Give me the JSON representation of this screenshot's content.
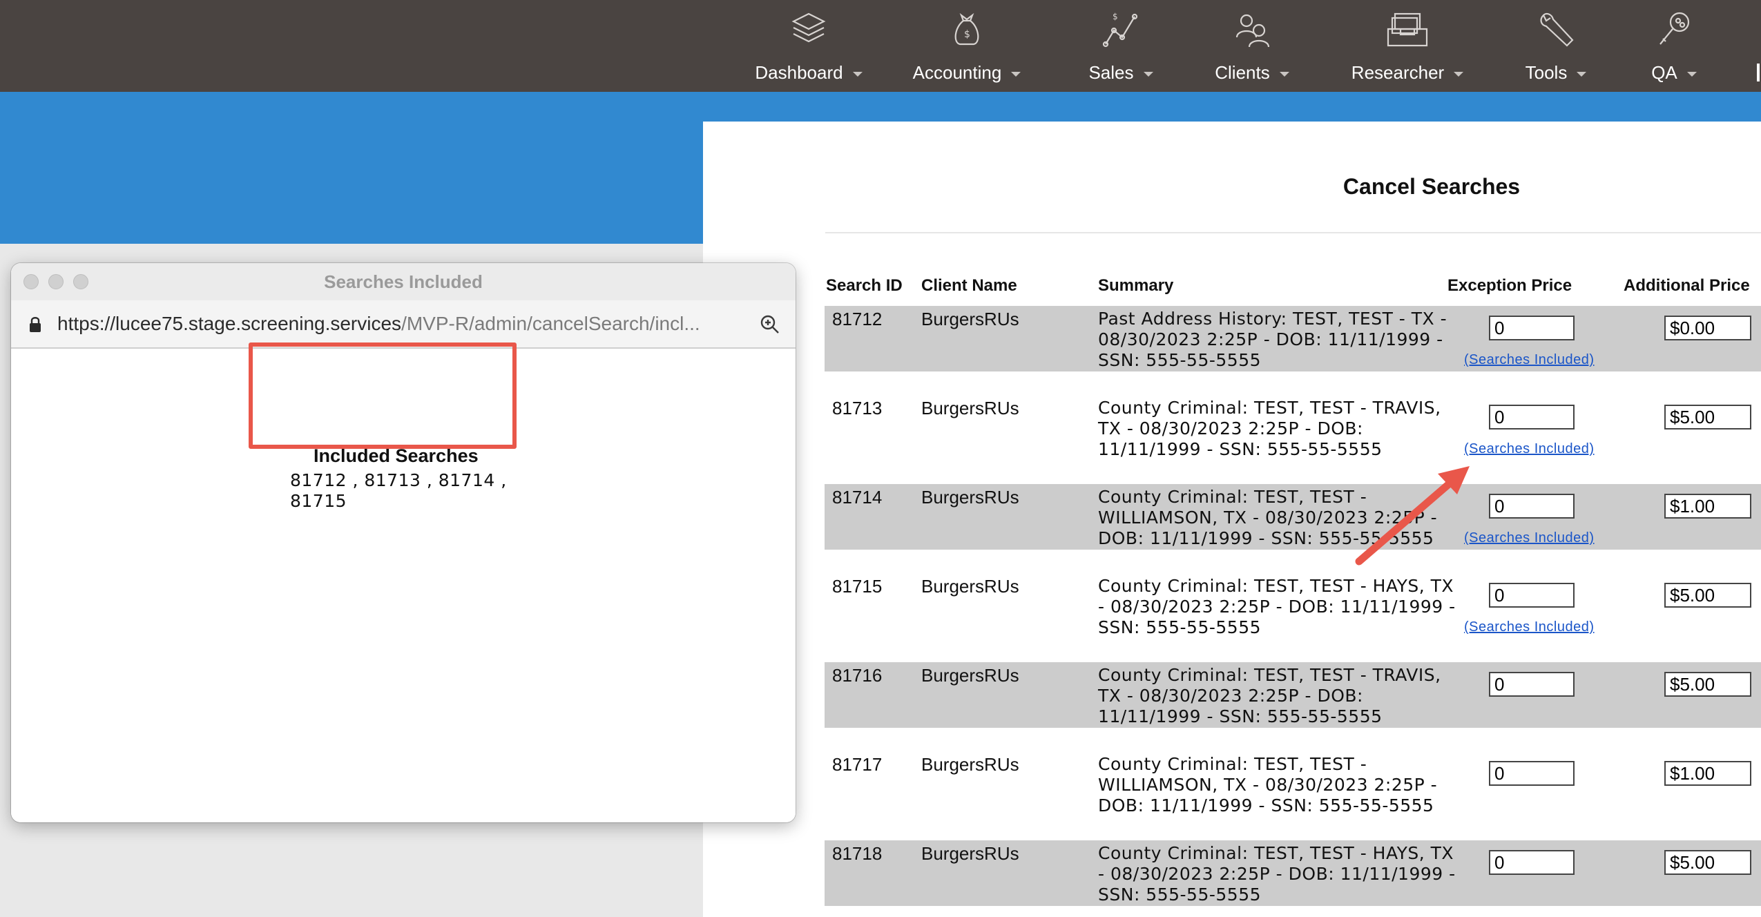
{
  "nav": {
    "items": [
      {
        "label": "Dashboard",
        "icon": "layers-icon"
      },
      {
        "label": "Accounting",
        "icon": "money-bag-icon"
      },
      {
        "label": "Sales",
        "icon": "sales-chart-icon"
      },
      {
        "label": "Clients",
        "icon": "users-icon"
      },
      {
        "label": "Researcher",
        "icon": "file-drawer-icon"
      },
      {
        "label": "Tools",
        "icon": "wrench-icon"
      },
      {
        "label": "QA",
        "icon": "magnifier-icon"
      }
    ]
  },
  "page": {
    "title": "Cancel Searches",
    "columns": {
      "search_id": "Search ID",
      "client_name": "Client Name",
      "summary": "Summary",
      "exception_price": "Exception Price",
      "additional_price": "Additional Price"
    },
    "rows": [
      {
        "id": "81712",
        "client": "BurgersRUs",
        "summary": "Past Address History: TEST, TEST - TX - 08/30/2023 2:25P - DOB: 11/11/1999 - SSN: 555-55-5555",
        "exception": "0",
        "additional": "$0.00",
        "link": "(Searches Included)"
      },
      {
        "id": "81713",
        "client": "BurgersRUs",
        "summary": "County Criminal: TEST, TEST - TRAVIS, TX - 08/30/2023 2:25P - DOB: 11/11/1999 - SSN: 555-55-5555",
        "exception": "0",
        "additional": "$5.00",
        "link": "(Searches Included)"
      },
      {
        "id": "81714",
        "client": "BurgersRUs",
        "summary": "County Criminal: TEST, TEST - WILLIAMSON, TX - 08/30/2023 2:25P - DOB: 11/11/1999 - SSN: 555-55-5555",
        "exception": "0",
        "additional": "$1.00",
        "link": "(Searches Included)"
      },
      {
        "id": "81715",
        "client": "BurgersRUs",
        "summary": "County Criminal: TEST, TEST - HAYS, TX - 08/30/2023 2:25P - DOB: 11/11/1999 - SSN: 555-55-5555",
        "exception": "0",
        "additional": "$5.00",
        "link": "(Searches Included)"
      },
      {
        "id": "81716",
        "client": "BurgersRUs",
        "summary": "County Criminal: TEST, TEST - TRAVIS, TX - 08/30/2023 2:25P - DOB: 11/11/1999 - SSN: 555-55-5555",
        "exception": "0",
        "additional": "$5.00"
      },
      {
        "id": "81717",
        "client": "BurgersRUs",
        "summary": "County Criminal: TEST, TEST - WILLIAMSON, TX - 08/30/2023 2:25P - DOB: 11/11/1999 - SSN: 555-55-5555",
        "exception": "0",
        "additional": "$1.00"
      },
      {
        "id": "81718",
        "client": "BurgersRUs",
        "summary": "County Criminal: TEST, TEST - HAYS, TX - 08/30/2023 2:25P - DOB: 11/11/1999 - SSN: 555-55-5555",
        "exception": "0",
        "additional": "$5.00"
      }
    ]
  },
  "popup": {
    "window_title": "Searches Included",
    "url_host": "https://lucee75.stage.screening.services",
    "url_path": "/MVP-R/admin/cancelSearch/incl...",
    "heading": "Included Searches",
    "ids_text": "81712 , 81713 , 81714 , 81715"
  },
  "colors": {
    "topbar": "#4a4441",
    "blue_band": "#3189d0",
    "row_shade": "#cccccc",
    "link": "#1a55c8",
    "annotation": "#e9574a"
  }
}
